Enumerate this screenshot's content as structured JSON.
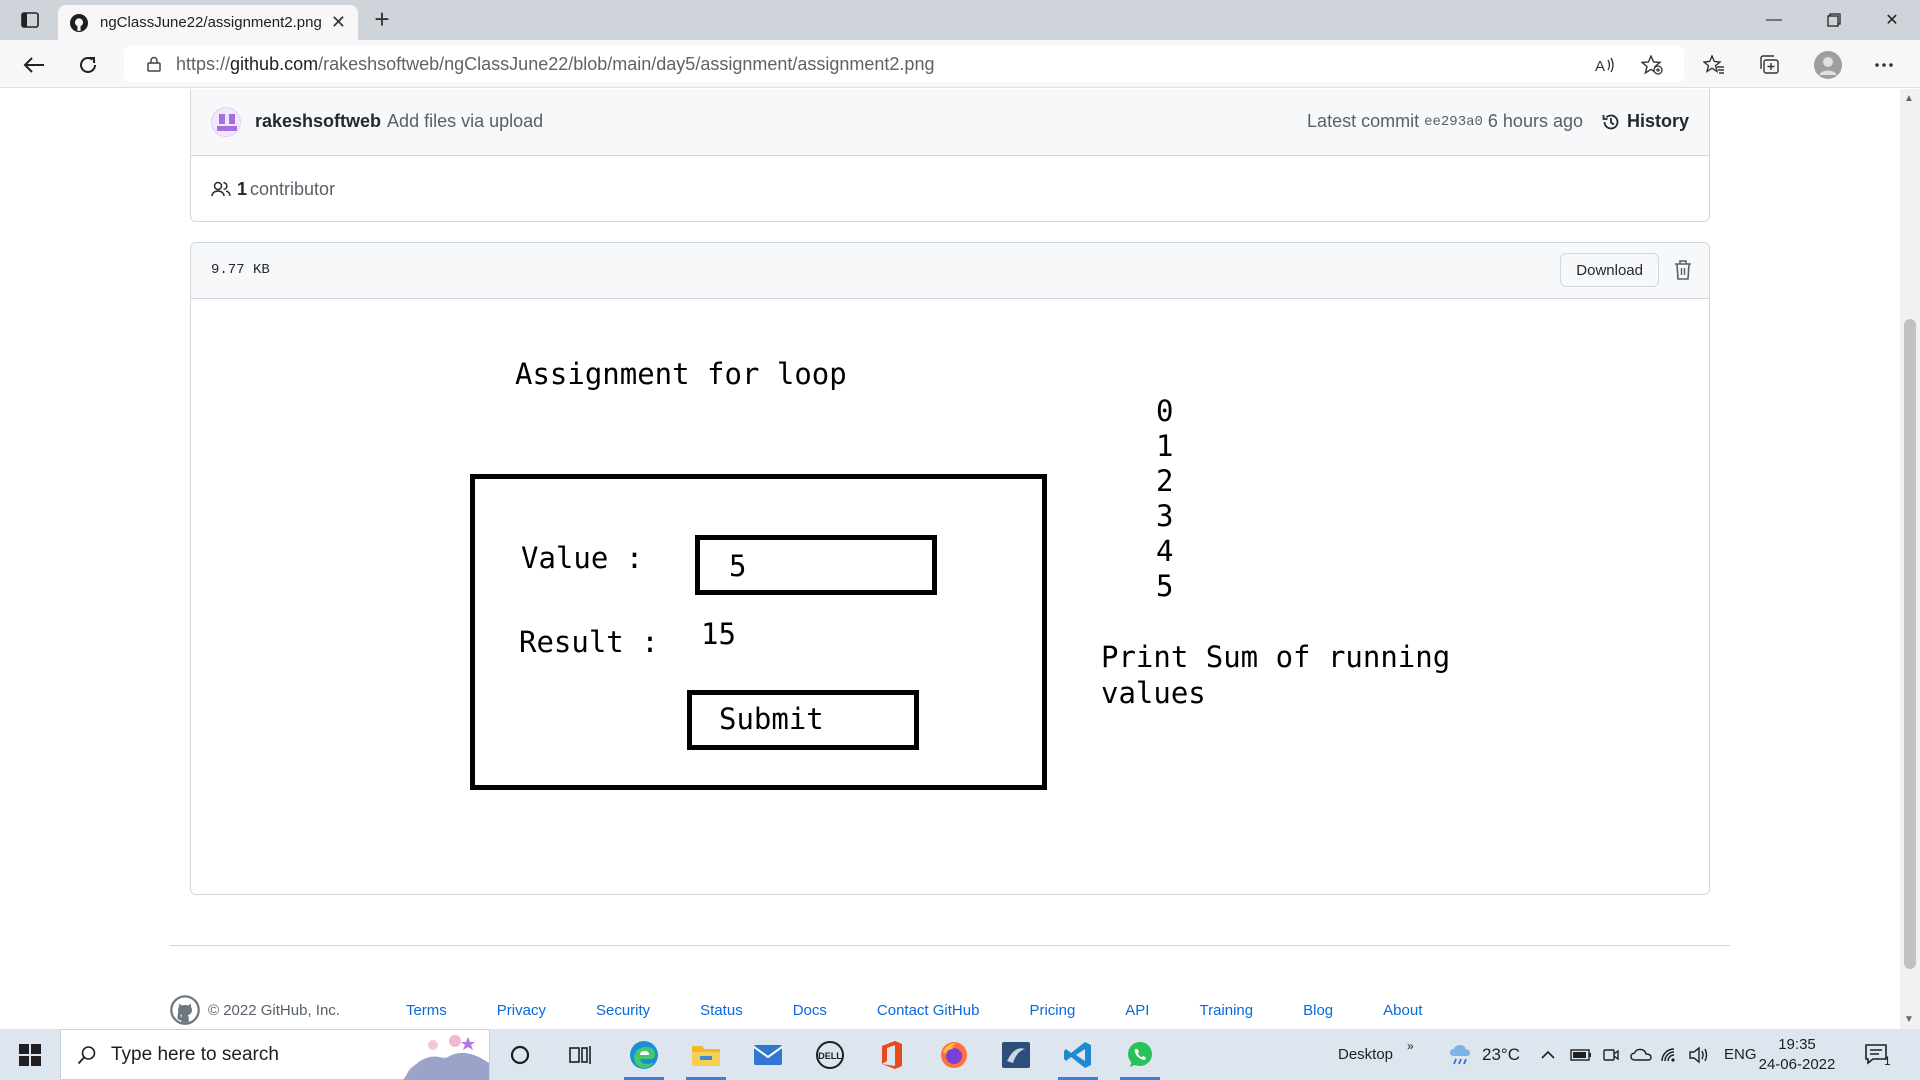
{
  "browser": {
    "tab_title": "ngClassJune22/assignment2.png",
    "url_prefix": "https://",
    "url_host": "github.com",
    "url_path": "/rakeshsoftweb/ngClassJune22/blob/main/day5/assignment/assignment2.png"
  },
  "commit": {
    "author": "rakeshsoftweb",
    "message": "Add files via upload",
    "latest_label": "Latest commit",
    "sha": "ee293a0",
    "time": "6 hours ago",
    "history_label": "History"
  },
  "contributors": {
    "count": "1",
    "label": "contributor"
  },
  "file": {
    "size": "9.77 KB",
    "download_label": "Download"
  },
  "assignment": {
    "title": "Assignment for loop",
    "value_label": "Value :",
    "value": "5",
    "result_label": "Result :",
    "result": "15",
    "submit_label": "Submit",
    "numbers": [
      "0",
      "1",
      "2",
      "3",
      "4",
      "5"
    ],
    "note": "Print Sum of running values"
  },
  "footer": {
    "copyright": "© 2022 GitHub, Inc.",
    "links": [
      "Terms",
      "Privacy",
      "Security",
      "Status",
      "Docs",
      "Contact GitHub",
      "Pricing",
      "API",
      "Training",
      "Blog",
      "About"
    ]
  },
  "taskbar": {
    "search_placeholder": "Type here to search",
    "desktop_label": "Desktop",
    "weather": "23°C",
    "language": "ENG",
    "time": "19:35",
    "date": "24-06-2022",
    "notification_count": "1"
  }
}
